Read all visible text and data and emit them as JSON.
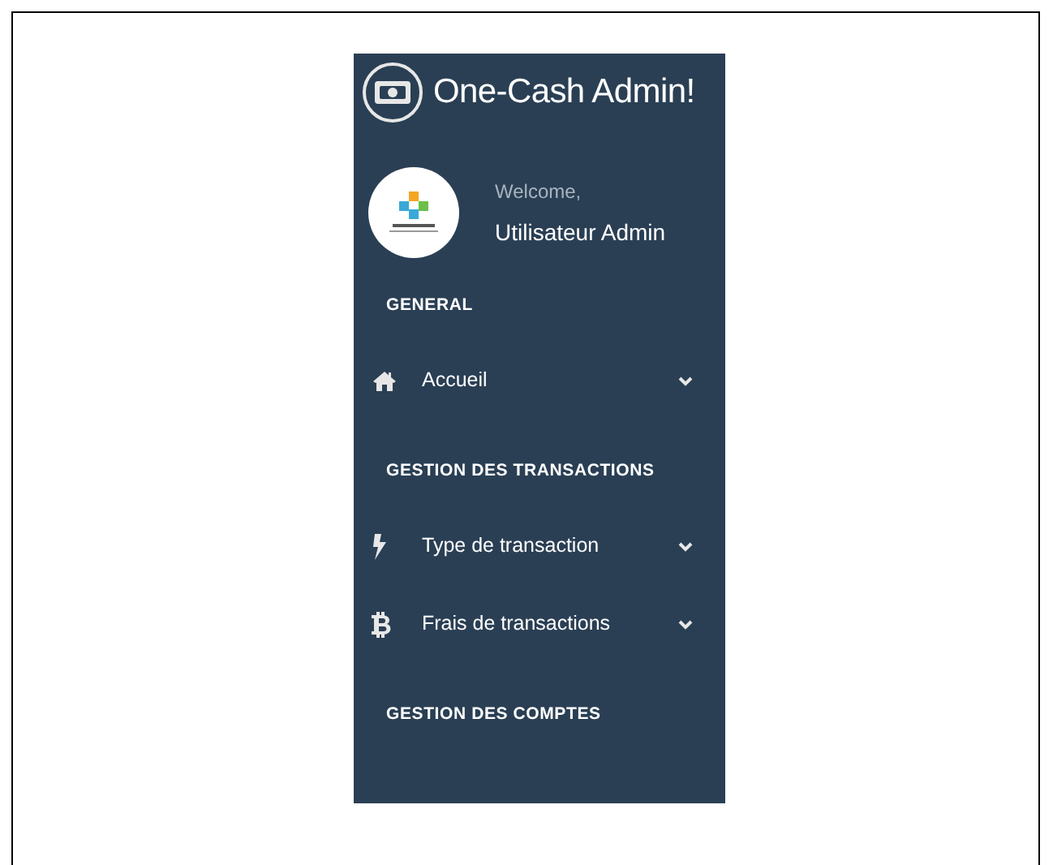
{
  "sidebar": {
    "title": "One-Cash Admin!",
    "welcome": "Welcome,",
    "user": "Utilisateur Admin",
    "sections": [
      {
        "heading": "GENERAL",
        "items": [
          {
            "label": "Accueil"
          }
        ]
      },
      {
        "heading": "GESTION DES TRANSACTIONS",
        "items": [
          {
            "label": "Type de transaction"
          },
          {
            "label": "Frais de transactions"
          }
        ]
      },
      {
        "heading": "GESTION DES COMPTES"
      }
    ]
  }
}
